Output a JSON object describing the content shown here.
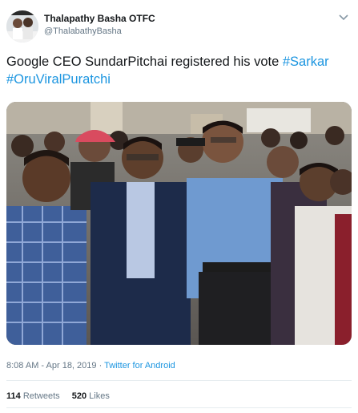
{
  "author": {
    "display_name": "Thalapathy Basha OTFC",
    "handle": "@ThalabathyBasha",
    "avatar_icon": "avatar-image"
  },
  "tweet": {
    "text": "Google CEO SundarPitchai registered his vote ",
    "hashtags": [
      "#Sarkar",
      "#OruViralPuratchi"
    ],
    "media_alt": "photo-group-of-people"
  },
  "meta": {
    "timestamp": "8:08 AM - Apr 18, 2019",
    "separator": " · ",
    "source": "Twitter for Android"
  },
  "stats": {
    "retweets_count": "114",
    "retweets_label": "Retweets",
    "likes_count": "520",
    "likes_label": "Likes"
  },
  "colors": {
    "link": "#1b95e0",
    "secondary_text": "#657786",
    "divider": "#e6ecf0"
  }
}
